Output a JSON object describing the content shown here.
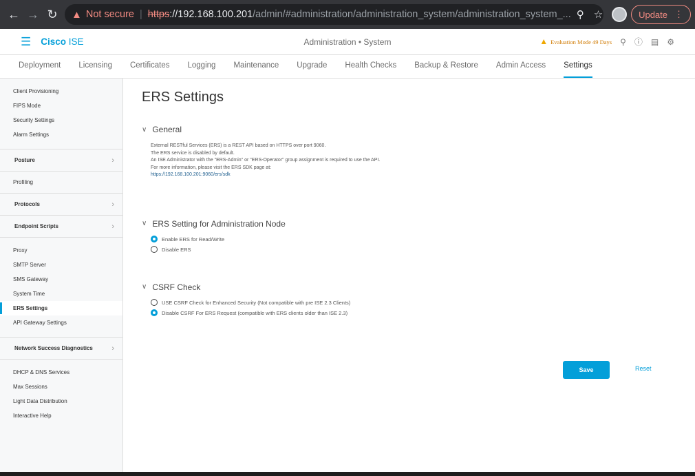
{
  "browser": {
    "not_secure": "Not secure",
    "url_scheme": "https",
    "url_host": "://192.168.100.201",
    "url_path": "/admin/#administration/administration_system/administration_system_...",
    "update_label": "Update"
  },
  "header": {
    "brand": "Cisco",
    "brand_suffix": "ISE",
    "center_title": "Administration • System",
    "evaluation": "Evaluation Mode 49 Days"
  },
  "tabs": [
    {
      "label": "Deployment"
    },
    {
      "label": "Licensing"
    },
    {
      "label": "Certificates"
    },
    {
      "label": "Logging"
    },
    {
      "label": "Maintenance"
    },
    {
      "label": "Upgrade"
    },
    {
      "label": "Health Checks"
    },
    {
      "label": "Backup & Restore"
    },
    {
      "label": "Admin Access"
    },
    {
      "label": "Settings"
    }
  ],
  "sidebar": {
    "group1": [
      "Client Provisioning",
      "FIPS Mode",
      "Security Settings",
      "Alarm Settings"
    ],
    "posture": "Posture",
    "profiling": "Profiling",
    "protocols": "Protocols",
    "endpoint_scripts": "Endpoint Scripts",
    "group2": [
      "Proxy",
      "SMTP Server",
      "SMS Gateway",
      "System Time",
      "ERS Settings",
      "API Gateway Settings"
    ],
    "network_success": "Network Success Diagnostics",
    "group3": [
      "DHCP & DNS Services",
      "Max Sessions",
      "Light Data Distribution",
      "Interactive Help"
    ]
  },
  "main": {
    "title": "ERS Settings",
    "general": {
      "heading": "General",
      "lines": [
        "External RESTful Services (ERS) is a REST API based on HTTPS over port 9060.",
        "The ERS service is disabled by default.",
        "An ISE Administrator with the \"ERS-Admin\" or \"ERS-Operator\" group assignment is required to use the API.",
        "For more information, please visit the ERS SDK page at:"
      ],
      "link": "https://192.168.100.201:9060/ers/sdk"
    },
    "admin_node": {
      "heading": "ERS Setting for Administration Node",
      "options": [
        "Enable ERS for Read/Write",
        "Disable ERS"
      ],
      "selected": 0
    },
    "csrf": {
      "heading": "CSRF Check",
      "options": [
        "USE CSRF Check for Enhanced Security (Not compatible with pre ISE 2.3 Clients)",
        "Disable CSRF For ERS Request (compatible with ERS clients older than ISE 2.3)"
      ],
      "selected": 1
    },
    "save_label": "Save",
    "reset_label": "Reset"
  }
}
